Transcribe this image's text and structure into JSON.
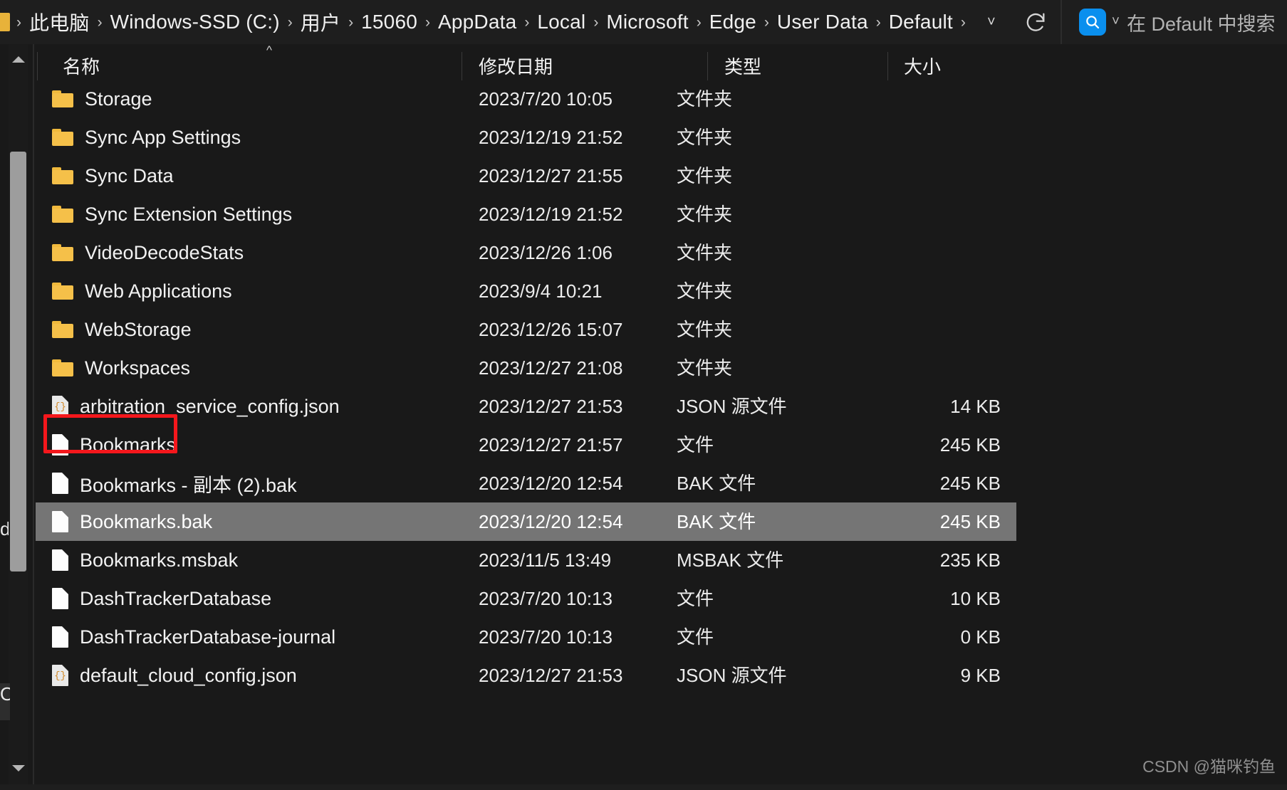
{
  "window": {
    "theme": "dark",
    "colors": {
      "background": "#191919",
      "chrome": "#1e1e1e",
      "selection": "#757575",
      "accent_blue": "#0a8fee",
      "folder_yellow": "#f5c049",
      "annotation_red": "#f4171c"
    }
  },
  "addressbar": {
    "home_icon": "this-pc-icon",
    "breadcrumbs": [
      "此电脑",
      "Windows-SSD (C:)",
      "用户",
      "15060",
      "AppData",
      "Local",
      "Microsoft",
      "Edge",
      "User Data",
      "Default"
    ],
    "separator": "›",
    "dropdown_icon": "chevron-down-icon",
    "refresh_icon": "refresh-icon"
  },
  "search": {
    "icon": "search-q-icon",
    "icon_glyph": "Q",
    "dropdown_icon": "chevron-down-icon",
    "placeholder": "在 Default 中搜索"
  },
  "columns": {
    "sort_indicator": "^",
    "headers": [
      {
        "label": "名称",
        "key": "name"
      },
      {
        "label": "修改日期",
        "key": "date"
      },
      {
        "label": "类型",
        "key": "type"
      },
      {
        "label": "大小",
        "key": "size"
      }
    ]
  },
  "files": [
    {
      "name": "Storage",
      "date": "2023/7/20 10:05",
      "type": "文件夹",
      "size": "",
      "icon": "folder-icon",
      "selected": false,
      "annotated": false
    },
    {
      "name": "Sync App Settings",
      "date": "2023/12/19 21:52",
      "type": "文件夹",
      "size": "",
      "icon": "folder-icon",
      "selected": false,
      "annotated": false
    },
    {
      "name": "Sync Data",
      "date": "2023/12/27 21:55",
      "type": "文件夹",
      "size": "",
      "icon": "folder-icon",
      "selected": false,
      "annotated": false
    },
    {
      "name": "Sync Extension Settings",
      "date": "2023/12/19 21:52",
      "type": "文件夹",
      "size": "",
      "icon": "folder-icon",
      "selected": false,
      "annotated": false
    },
    {
      "name": "VideoDecodeStats",
      "date": "2023/12/26 1:06",
      "type": "文件夹",
      "size": "",
      "icon": "folder-icon",
      "selected": false,
      "annotated": false
    },
    {
      "name": "Web Applications",
      "date": "2023/9/4 10:21",
      "type": "文件夹",
      "size": "",
      "icon": "folder-icon",
      "selected": false,
      "annotated": false
    },
    {
      "name": "WebStorage",
      "date": "2023/12/26 15:07",
      "type": "文件夹",
      "size": "",
      "icon": "folder-icon",
      "selected": false,
      "annotated": false
    },
    {
      "name": "Workspaces",
      "date": "2023/12/27 21:08",
      "type": "文件夹",
      "size": "",
      "icon": "folder-icon",
      "selected": false,
      "annotated": false
    },
    {
      "name": "arbitration_service_config.json",
      "date": "2023/12/27 21:53",
      "type": "JSON 源文件",
      "size": "14 KB",
      "icon": "json-file-icon",
      "selected": false,
      "annotated": false
    },
    {
      "name": "Bookmarks",
      "date": "2023/12/27 21:57",
      "type": "文件",
      "size": "245 KB",
      "icon": "file-icon",
      "selected": false,
      "annotated": true
    },
    {
      "name": "Bookmarks - 副本 (2).bak",
      "date": "2023/12/20 12:54",
      "type": "BAK 文件",
      "size": "245 KB",
      "icon": "file-icon",
      "selected": false,
      "annotated": false
    },
    {
      "name": "Bookmarks.bak",
      "date": "2023/12/20 12:54",
      "type": "BAK 文件",
      "size": "245 KB",
      "icon": "file-icon",
      "selected": true,
      "annotated": false
    },
    {
      "name": "Bookmarks.msbak",
      "date": "2023/11/5 13:49",
      "type": "MSBAK 文件",
      "size": "235 KB",
      "icon": "file-icon",
      "selected": false,
      "annotated": false
    },
    {
      "name": "DashTrackerDatabase",
      "date": "2023/7/20 10:13",
      "type": "文件",
      "size": "10 KB",
      "icon": "file-icon",
      "selected": false,
      "annotated": false
    },
    {
      "name": "DashTrackerDatabase-journal",
      "date": "2023/7/20 10:13",
      "type": "文件",
      "size": "0 KB",
      "icon": "file-icon",
      "selected": false,
      "annotated": false
    },
    {
      "name": "default_cloud_config.json",
      "date": "2023/12/27 21:53",
      "type": "JSON 源文件",
      "size": "9 KB",
      "icon": "json-file-icon",
      "selected": false,
      "annotated": false
    }
  ],
  "scrollbar": {
    "up_arrow_icon": "scroll-up-arrow-icon",
    "down_arrow_icon": "scroll-down-arrow-icon",
    "thumb": "scroll-thumb"
  },
  "watermark": "CSDN @猫咪钓鱼"
}
